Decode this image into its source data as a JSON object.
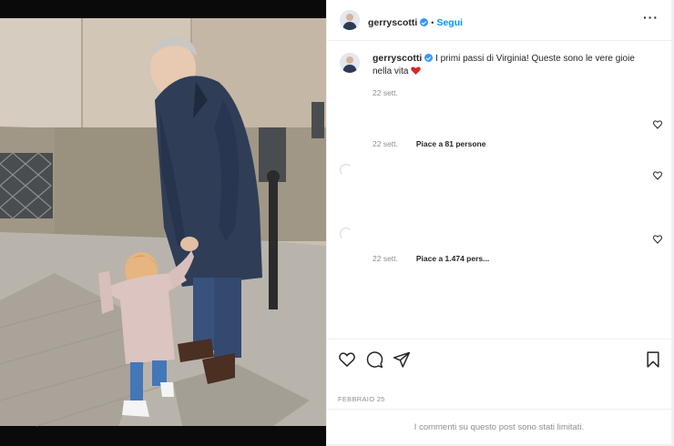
{
  "post": {
    "author": "gerryscotti",
    "verified": true,
    "follow_label": "Segui",
    "more_icon": "more-horizontal-icon",
    "caption": "I primi passi di Virginia! Queste sono le vere gioie nella vita",
    "caption_emoji": "heart-emoji",
    "caption_time": "22 sett."
  },
  "comments": [
    {
      "time": "22 sett.",
      "likes": "Piace a 81 persone"
    },
    {
      "time": "22 sett.",
      "likes": "Piace a 1.474 pers..."
    }
  ],
  "actions": {
    "like_icon": "heart-icon",
    "comment_icon": "comment-icon",
    "share_icon": "share-icon",
    "save_icon": "bookmark-icon"
  },
  "post_date": "FEBBRAIO 25",
  "comments_limited": "I commenti su questo post sono stati limitati.",
  "colors": {
    "accent": "#0095f6",
    "verified": "#3897f0",
    "text": "#262626",
    "muted": "#8e8e8e"
  }
}
